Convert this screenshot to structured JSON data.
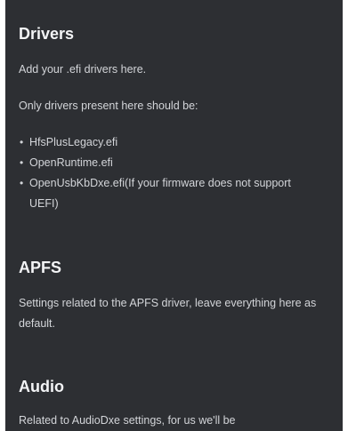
{
  "sections": {
    "drivers": {
      "title": "Drivers",
      "intro": "Add your .efi drivers here.",
      "note": "Only drivers present here should be:",
      "items": [
        "HfsPlusLegacy.efi",
        "OpenRuntime.efi",
        "OpenUsbKbDxe.efi(If your firmware does not support UEFI)"
      ]
    },
    "apfs": {
      "title": "APFS",
      "description": "Settings related to the APFS driver, leave everything here as default."
    },
    "audio": {
      "title": "Audio",
      "description": "Related to AudioDxe settings, for us we'll be"
    }
  }
}
